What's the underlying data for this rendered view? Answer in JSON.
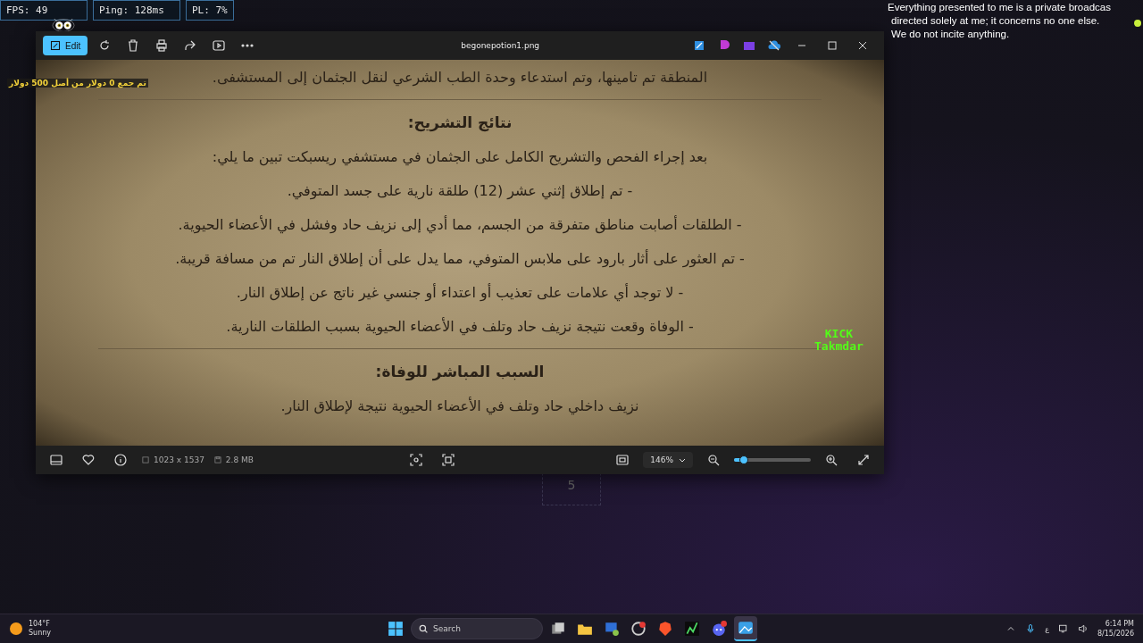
{
  "stats_bar": {
    "fps": "FPS: 49",
    "ping": "Ping: 128ms",
    "packet_loss": "PL: 7%"
  },
  "donation_text": "تم جمع 0 دولار من أصل 500 دولار",
  "disclaimer": [
    "Everything presented to me is a private broadcas",
    "directed solely at me; it concerns no one else.",
    "We do not incite anything."
  ],
  "viewer": {
    "title": "begonepotion1.png",
    "edit_label": "Edit",
    "document": [
      {
        "kind": "text",
        "text": "المنطقة تم تامينها، وتم استدعاء وحدة الطب الشرعي لنقل الجثمان إلى المستشفى."
      },
      {
        "kind": "rule"
      },
      {
        "kind": "heading",
        "text": "نتائج التشريح:"
      },
      {
        "kind": "text",
        "text": "بعد إجراء الفحص والتشريح الكامل على الجثمان في مستشفي ريسبكت تبين ما يلي:"
      },
      {
        "kind": "text",
        "text": "- تم إطلاق إثني عشر (12) طلقة نارية على جسد المتوفي."
      },
      {
        "kind": "text",
        "text": "- الطلقات أصابت مناطق متفرقة من الجسم، مما أدي إلى نزيف حاد وفشل في الأعضاء الحيوية."
      },
      {
        "kind": "text",
        "text": "- تم العثور على أثار بارود على ملابس المتوفي، مما يدل على أن إطلاق النار تم من مسافة قريبة."
      },
      {
        "kind": "text",
        "text": "- لا توجد أي علامات على تعذيب أو اعتداء أو جنسي غير ناتج عن إطلاق النار."
      },
      {
        "kind": "text",
        "text": "- الوفاة وقعت نتيجة نزيف حاد وتلف في الأعضاء الحيوية بسبب الطلقات النارية."
      },
      {
        "kind": "rule"
      },
      {
        "kind": "heading",
        "text": "السبب المباشر للوفاة:"
      },
      {
        "kind": "text",
        "text": "نزيف داخلي حاد وتلف في الأعضاء الحيوية نتيجة لإطلاق النار."
      }
    ],
    "dimensions": "1023 x 1537",
    "file_size": "2.8 MB",
    "zoom": "146%",
    "zoom_slider": {
      "level": 0.13
    }
  },
  "stream_overlay": {
    "platform": "KICK",
    "channel": "Takmdar"
  },
  "tile_label": "5",
  "taskbar": {
    "weather": {
      "temperature": "104°F",
      "condition": "Sunny"
    },
    "search": {
      "placeholder": "Search"
    },
    "apps": [
      {
        "kind": "taskview",
        "active": false
      },
      {
        "kind": "folder",
        "active": false
      },
      {
        "kind": "monitor",
        "active": false
      },
      {
        "kind": "browser",
        "active": false
      },
      {
        "kind": "lion",
        "active": false
      },
      {
        "kind": "chart",
        "active": false
      },
      {
        "kind": "chat",
        "active": false
      },
      {
        "kind": "photos",
        "active": true
      }
    ],
    "input_language": "ع",
    "time": "6:14 PM",
    "date": "8/15/2026"
  }
}
